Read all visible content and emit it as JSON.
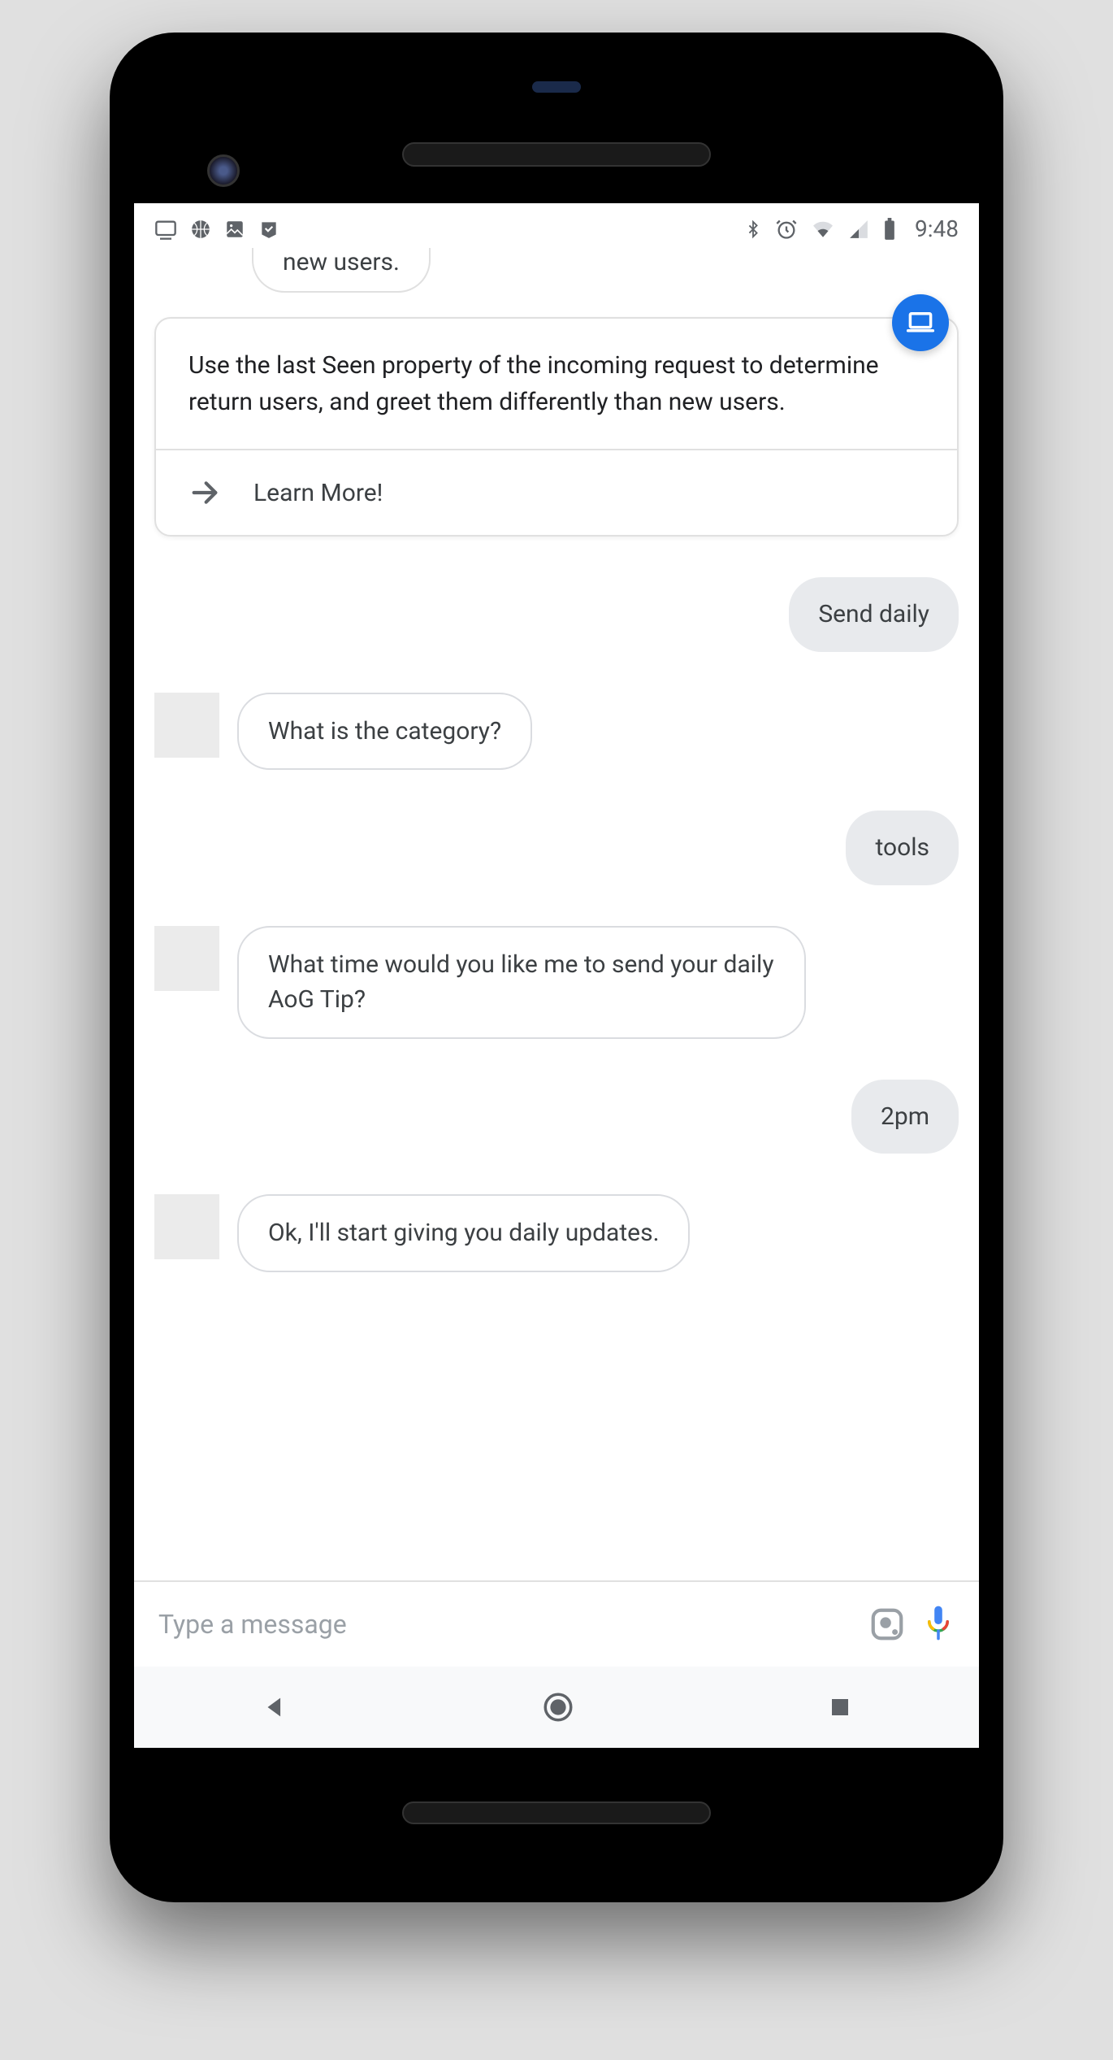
{
  "status": {
    "time": "9:48",
    "left_icons": [
      "cast-icon",
      "basketball-icon",
      "image-icon",
      "check-icon"
    ],
    "right_icons": [
      "bluetooth-icon",
      "alarm-icon",
      "wifi-icon",
      "signal-icon",
      "battery-icon"
    ]
  },
  "truncated_message": "new users.",
  "card": {
    "body": "Use the last Seen property of the incoming request to determine return users, and greet them differently than new users.",
    "action_label": "Learn More!",
    "badge_icon": "laptop-icon"
  },
  "messages": [
    {
      "role": "user",
      "text": "Send daily"
    },
    {
      "role": "assistant",
      "text": "What is the category?"
    },
    {
      "role": "user",
      "text": "tools"
    },
    {
      "role": "assistant",
      "text": "What time would you like me to send your daily AoG Tip?"
    },
    {
      "role": "user",
      "text": "2pm"
    },
    {
      "role": "assistant",
      "text": "Ok, I'll start giving you daily updates."
    }
  ],
  "input": {
    "placeholder": "Type a message"
  }
}
